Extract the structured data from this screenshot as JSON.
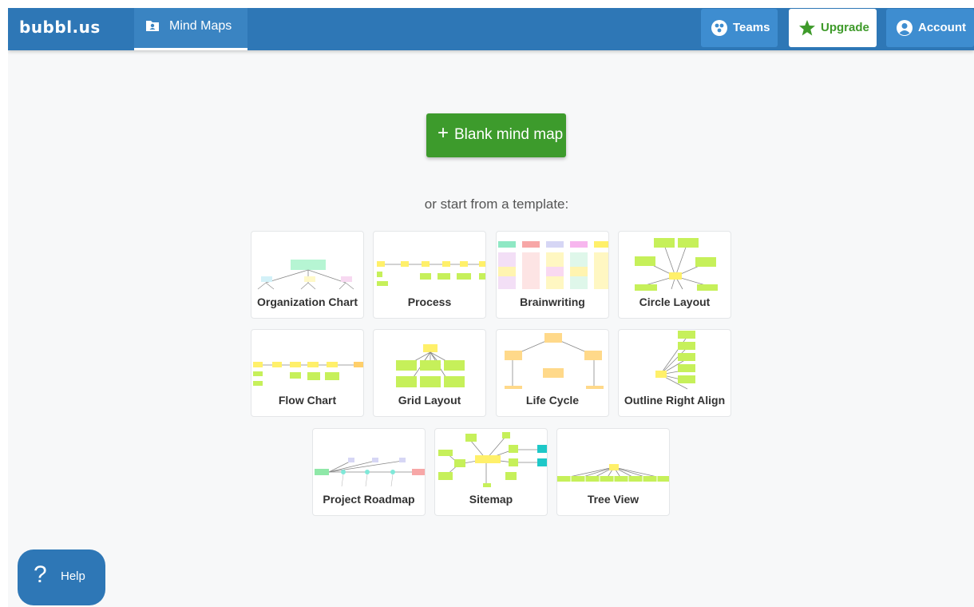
{
  "header": {
    "logo": "bubbl.us",
    "tab_label": "Mind Maps",
    "tab_icon": "folder-user-icon",
    "teams_label": "Teams",
    "upgrade_label": "Upgrade",
    "account_label": "Account",
    "teams_icon": "teams-icon",
    "upgrade_icon": "star-icon",
    "account_icon": "user-circle-icon"
  },
  "main": {
    "blank_button": "Blank mind map",
    "blank_button_icon": "plus-icon",
    "subtitle": "or start from a template:"
  },
  "templates": [
    {
      "label": "Organization Chart"
    },
    {
      "label": "Process"
    },
    {
      "label": "Brainwriting"
    },
    {
      "label": "Circle Layout"
    },
    {
      "label": "Flow Chart"
    },
    {
      "label": "Grid Layout"
    },
    {
      "label": "Life Cycle"
    },
    {
      "label": "Outline Right Align"
    },
    {
      "label": "Project Roadmap"
    },
    {
      "label": "Sitemap"
    },
    {
      "label": "Tree View"
    }
  ],
  "help": {
    "label": "Help",
    "icon": "question-icon"
  },
  "colors": {
    "header_blue": "#2e77b6",
    "button_blue": "#3e8dd0",
    "green": "#3d9b2c",
    "node_yellow": "#fff06a",
    "node_green": "#c6f05a"
  }
}
